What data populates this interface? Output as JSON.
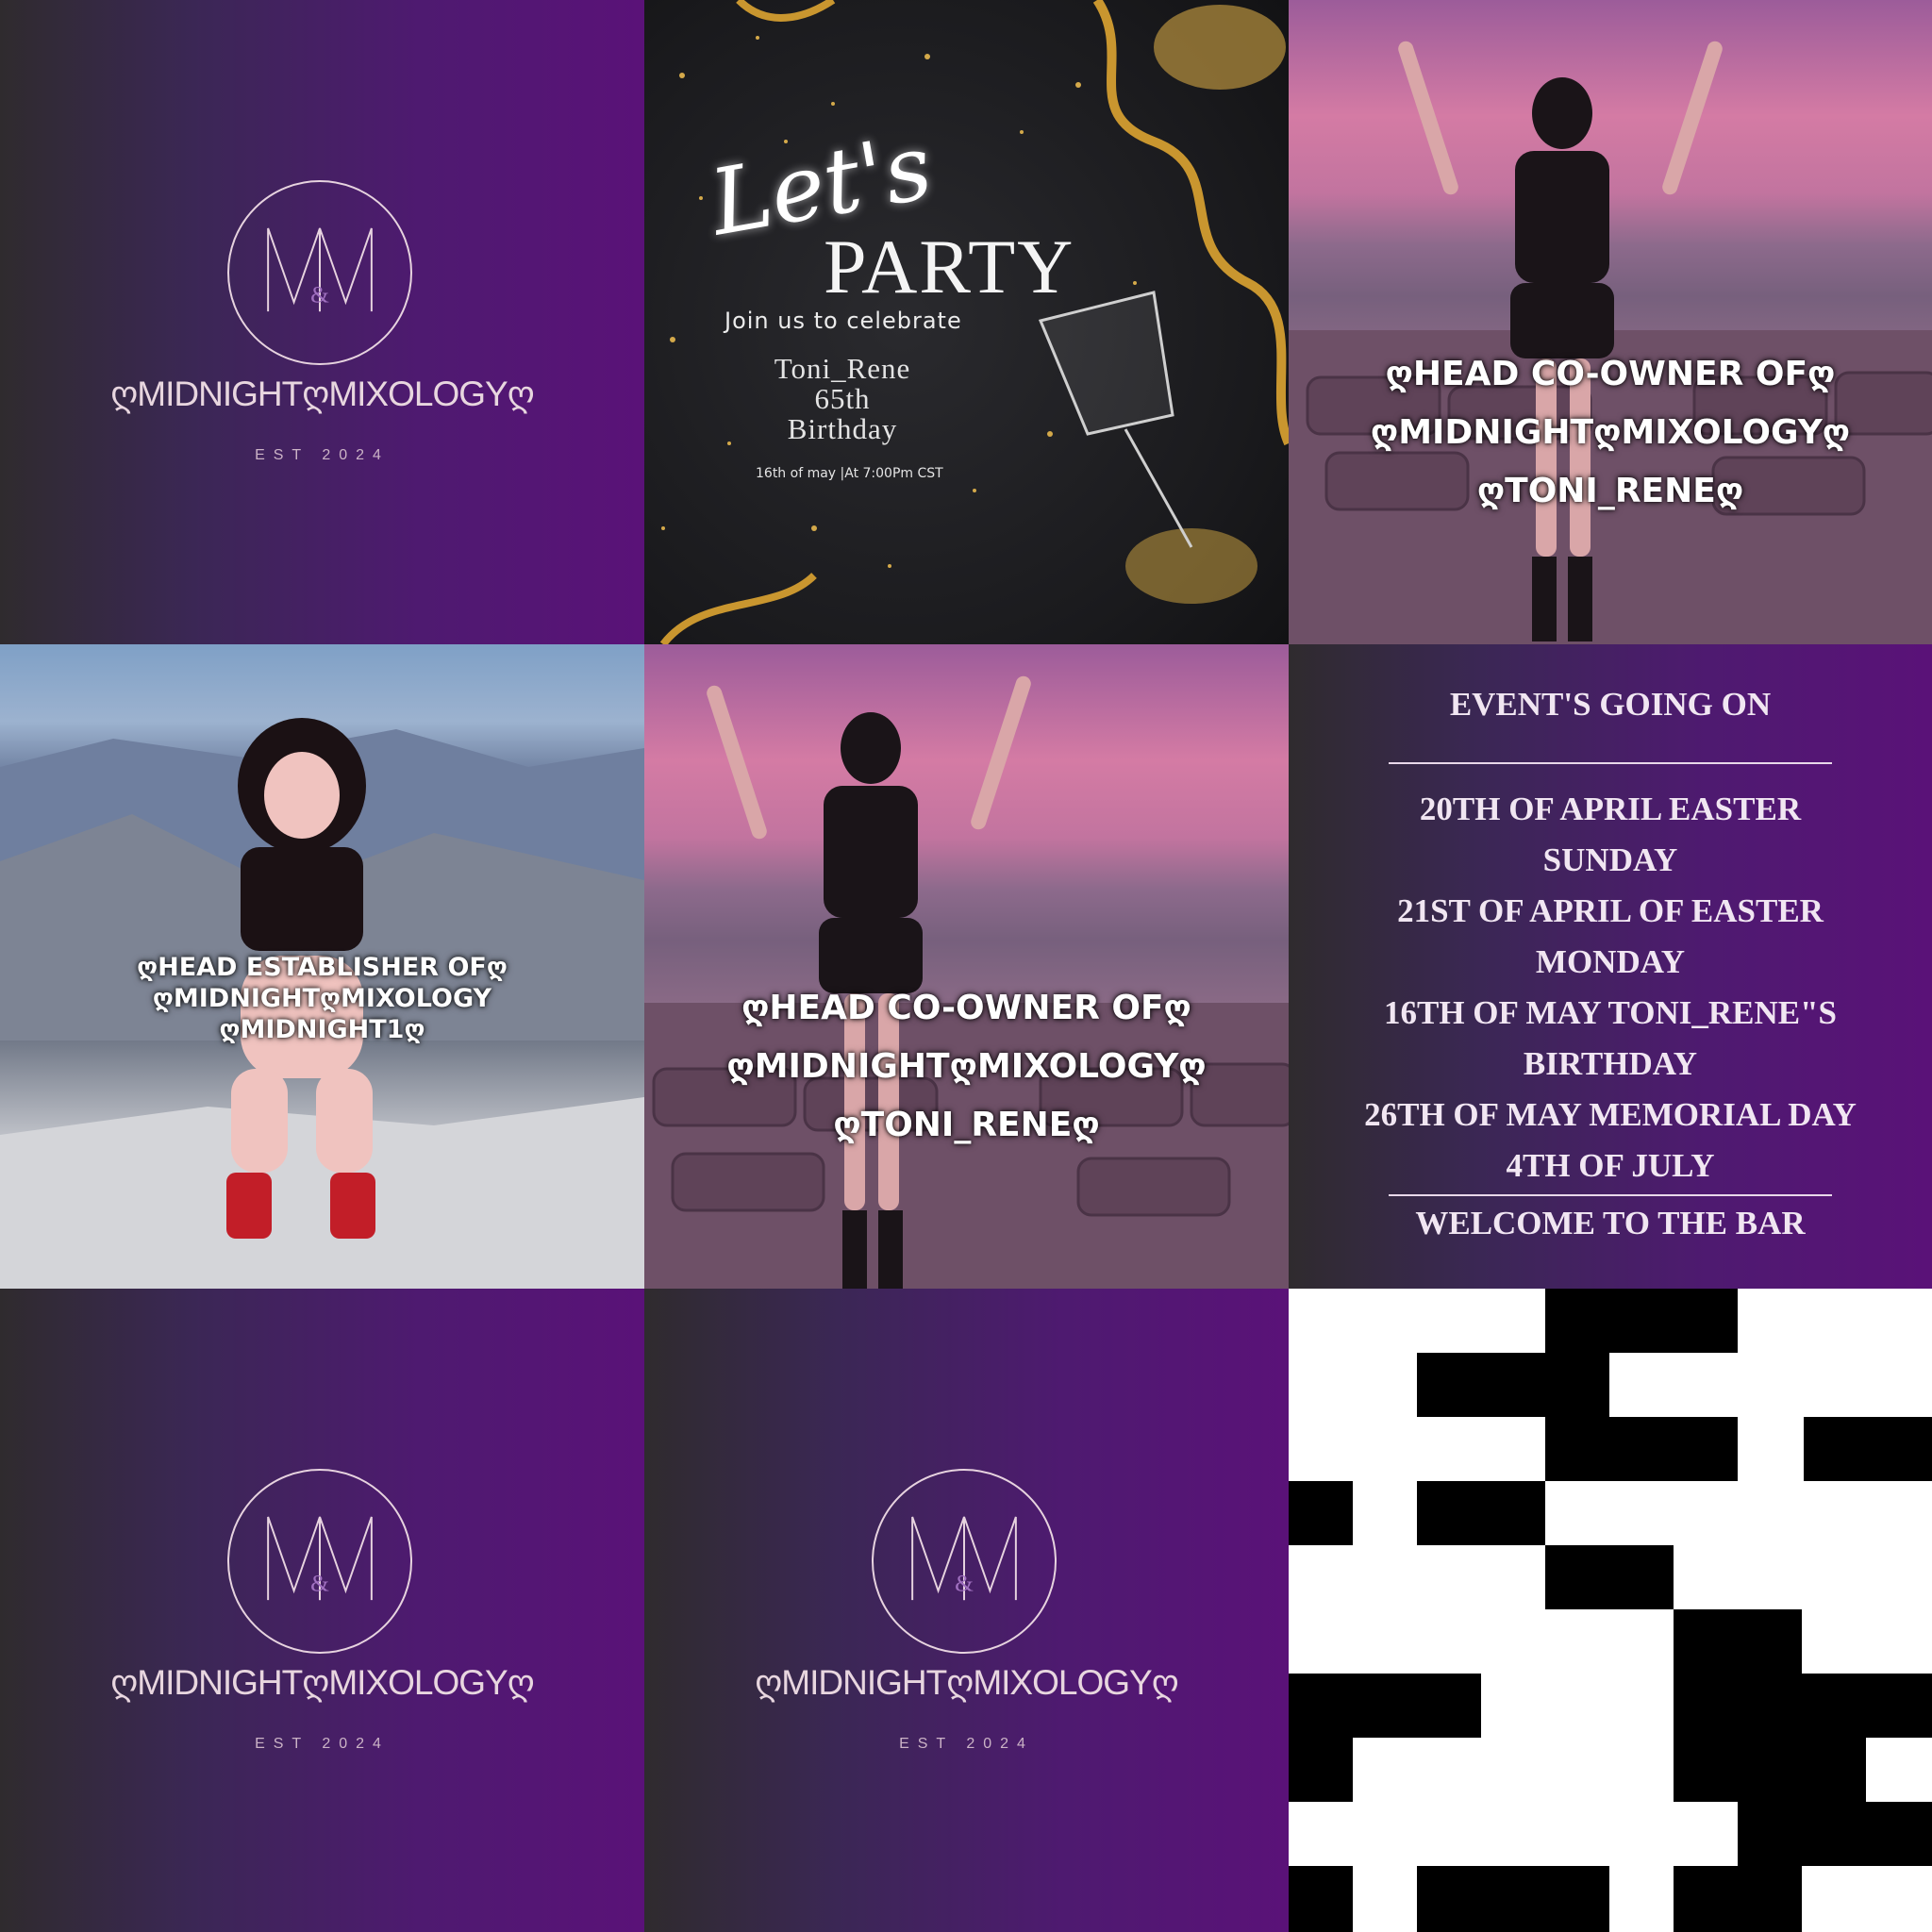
{
  "logo": {
    "brand": "ღMIDNIGHTღMIXOLOGYღ",
    "established": "EST 2024",
    "monogram": "M&M"
  },
  "party": {
    "script_title": "Let's",
    "main_title": "PARTY",
    "invite": "Join us to celebrate",
    "honoree": "Toni_Rene",
    "age": "65th",
    "occasion": "Birthday",
    "datetime": "16th of may |At 7:00Pm CST"
  },
  "coowner": {
    "line1": "ღHEAD CO-OWNER OFღ",
    "line2": "ღMIDNIGHTღMIXOLOGYღ",
    "line3": "ღTONI_RENEღ"
  },
  "establisher": {
    "line1": "ღHEAD ESTABLISHER OFღ",
    "line2": "ღMIDNIGHTღMIXOLOGY",
    "line3": "ღMIDNIGHT1ღ"
  },
  "events": {
    "title": "EVENT'S GOING ON",
    "lines": [
      "20TH OF APRIL EASTER",
      "SUNDAY",
      "21ST OF APRIL  OF EASTER",
      "MONDAY",
      "16TH OF MAY TONI_RENE\"S",
      "BIRTHDAY",
      "26TH OF MAY MEMORIAL DAY",
      "4TH OF JULY"
    ],
    "footer": "WELCOME TO THE BAR"
  }
}
